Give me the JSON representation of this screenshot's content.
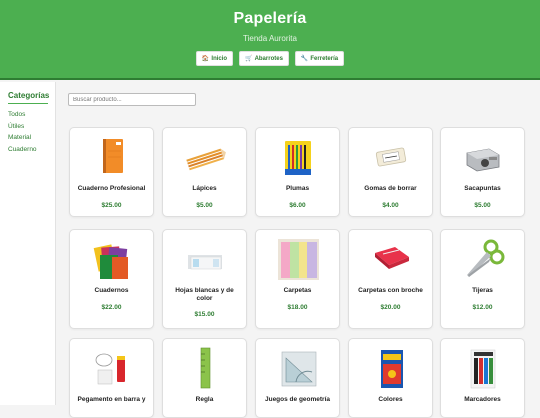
{
  "header": {
    "title": "Papelería",
    "subtitle": "Tienda Aurorita",
    "nav": [
      {
        "icon": "house-icon",
        "glyph": "🏠",
        "label": "Inicio"
      },
      {
        "icon": "cart-icon",
        "glyph": "🛒",
        "label": "Abarrotes"
      },
      {
        "icon": "wrench-icon",
        "glyph": "🔧",
        "label": "Ferretería"
      }
    ]
  },
  "sidebar": {
    "title": "Categorías",
    "items": [
      "Todos",
      "Útiles",
      "Material",
      "Cuaderno"
    ]
  },
  "search": {
    "placeholder": "Buscar producto..."
  },
  "products": [
    {
      "name": "Cuaderno Profesional",
      "price": "$25.00"
    },
    {
      "name": "Lápices",
      "price": "$5.00"
    },
    {
      "name": "Plumas",
      "price": "$6.00"
    },
    {
      "name": "Gomas de borrar",
      "price": "$4.00"
    },
    {
      "name": "Sacapuntas",
      "price": "$5.00"
    },
    {
      "name": "Cuadernos",
      "price": "$22.00"
    },
    {
      "name": "Hojas blancas y de color",
      "price": "$15.00"
    },
    {
      "name": "Carpetas",
      "price": "$18.00"
    },
    {
      "name": "Carpetas con broche",
      "price": "$20.00"
    },
    {
      "name": "Tijeras",
      "price": "$12.00"
    },
    {
      "name": "Pegamento en barra y",
      "price": ""
    },
    {
      "name": "Regla",
      "price": ""
    },
    {
      "name": "Juegos de geometría",
      "price": ""
    },
    {
      "name": "Colores",
      "price": ""
    },
    {
      "name": "Marcadores",
      "price": ""
    }
  ],
  "colors": {
    "primary": "#4caf50",
    "primary_dark": "#2e7d32",
    "background": "#f4f4f4"
  }
}
